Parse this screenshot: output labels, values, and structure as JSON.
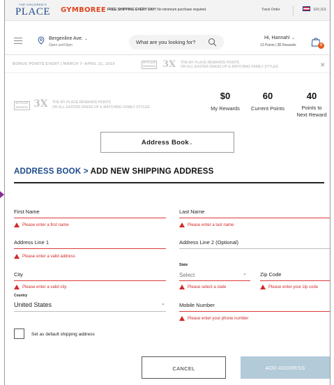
{
  "topbar": {
    "brand_place_small": "THE CHILDREN'S",
    "brand_place": "PLACE",
    "brand_gymboree": "GYMBOREE",
    "shipping_bold": "FREE SHIPPING EVERY DAY!",
    "shipping_rest": " No minimum purchase required.",
    "track_order": "Track Order",
    "language": "EN | ES",
    "flag_icon": "us-flag-icon"
  },
  "header": {
    "menu_icon": "hamburger-menu-icon",
    "store_name": "Bergenline Ave.",
    "store_hours": "Open until 8pm",
    "search_placeholder": "What are you looking for?",
    "greeting": "Hi, Hannah!",
    "points_summary": "13 Points  |  $5 Rewards",
    "bag_count": "0"
  },
  "bonus_strip": {
    "text": "BONUS POINTS EVENT  |  MARCH 7–APRIL 21, 2019",
    "logo_text": "MY PLACE REWARDS",
    "multiplier": "3X",
    "line1": "THE MY PLACE REWARDS POINTS",
    "line2": "ON ALL EASTER DRESS UP & MATCHING FAMILY STYLES"
  },
  "rewards": {
    "logo_text": "MY PLACE REWARDS",
    "multiplier": "3X",
    "line1": "THE MY PLACE REWARDS POINTS",
    "line2": "ON ALL EASTER DRESS UP & MATCHING FAMILY STYLES",
    "my_rewards_value": "$0",
    "my_rewards_label": "My Rewards",
    "current_points_value": "60",
    "current_points_label": "Current Points",
    "next_reward_value": "40",
    "next_reward_label_1": "Points to",
    "next_reward_label_2": "Next Reward"
  },
  "address_dropdown": {
    "label": "Address Book"
  },
  "heading": {
    "crumb": "ADDRESS BOOK",
    "separator": " > ",
    "current": "ADD NEW SHIPPING ADDRESS"
  },
  "form": {
    "first_name_label": "First Name",
    "first_name_error": "Please enter a first name",
    "last_name_label": "Last Name",
    "last_name_error": "Please enter a last name",
    "address1_label": "Address Line 1",
    "address1_error": "Please enter a valid address",
    "address2_label": "Address Line 2 (Optional)",
    "city_label": "City",
    "city_error": "Please enter a valid city",
    "state_label": "State",
    "state_value": "Select",
    "state_error": "Please select a state",
    "zip_label": "Zip Code",
    "zip_error": "Please enter your zip code",
    "country_label": "Country",
    "country_value": "United States",
    "mobile_label": "Mobile Number",
    "mobile_error": "Please enter your phone number",
    "default_checkbox_label": "Set as default shipping address"
  },
  "buttons": {
    "cancel": "CANCEL",
    "add": "ADD ADDRESS"
  },
  "colors": {
    "brand_blue": "#1f4a8a",
    "gymboree_orange": "#e0431f",
    "error_red": "#d42a2a",
    "disabled_button": "#b3cad8"
  }
}
